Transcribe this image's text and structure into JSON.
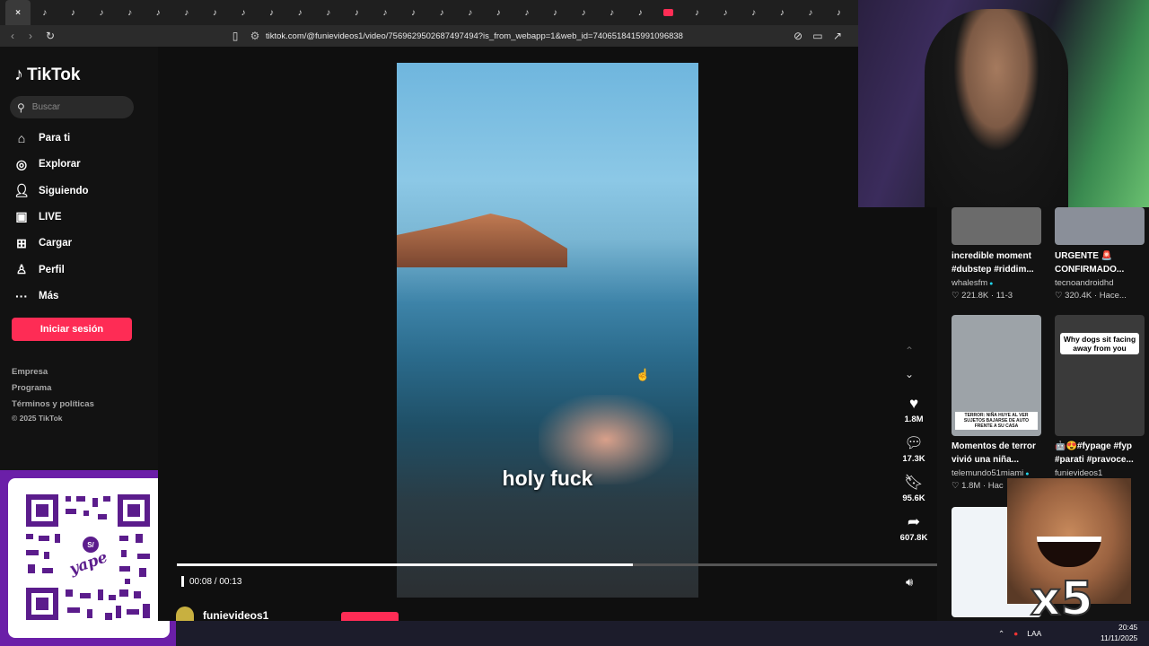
{
  "browser": {
    "tabs": [
      "×",
      "♪",
      "♪",
      "♪",
      "♪",
      "♪",
      "♪",
      "♪",
      "♪",
      "♪",
      "♪",
      "♪",
      "♪",
      "♪",
      "♪",
      "♪",
      "♪",
      "♪",
      "♪",
      "♪",
      "♪",
      "♪",
      "♪",
      "♪",
      "♪",
      "♪",
      "♪",
      "♪",
      "♪",
      "♪"
    ],
    "url": "tiktok.com/@funievideos1/video/7569629502687497494?is_from_webapp=1&web_id=7406518415991096838"
  },
  "sidebar": {
    "logo": "TikTok",
    "search_placeholder": "Buscar",
    "items": [
      {
        "label": "Para ti",
        "icon": "home-icon"
      },
      {
        "label": "Explorar",
        "icon": "compass-icon"
      },
      {
        "label": "Siguiendo",
        "icon": "following-icon"
      },
      {
        "label": "LIVE",
        "icon": "live-icon"
      },
      {
        "label": "Cargar",
        "icon": "upload-icon"
      },
      {
        "label": "Perfil",
        "icon": "profile-icon"
      },
      {
        "label": "Más",
        "icon": "more-icon"
      }
    ],
    "login_label": "Iniciar sesión",
    "footer": [
      "Empresa",
      "Programa",
      "Términos y políticas",
      "© 2025 TikTok"
    ]
  },
  "yape": {
    "brand": "yape",
    "badge": "S/"
  },
  "video": {
    "caption": "holy fuck",
    "time": "00:08 / 00:13",
    "progress": 0.6,
    "likes": "1.8M",
    "comments": "17.3K",
    "saves": "95.6K",
    "shares": "607.8K",
    "author": "funievideos1"
  },
  "recommended": [
    {
      "title": "incredible moment #dubstep #riddim...",
      "author": "whalesfm",
      "verified": true,
      "views": "221.8K",
      "date": "11-3",
      "thumb_color": "#6b6b6b"
    },
    {
      "title": "URGENTE 🚨 CONFIRMADO...",
      "author": "tecnoandroidhd",
      "verified": false,
      "views": "320.4K",
      "date": "Hace...",
      "thumb_color": "#8a8f99"
    },
    {
      "title": "Momentos de terror vivió una niña...",
      "author": "telemundo51miami",
      "verified": true,
      "views": "1.8M",
      "date": "Hac",
      "thumb_color": "#9da3a8",
      "overlay": "TERROR: NIÑA HUYE AL VER SUJETOS BAJARSE DE AUTO FRENTE A SU CASA"
    },
    {
      "title": "🤖😍#fypage #fyp #parati #pravoce...",
      "author": "funievideos1",
      "verified": false,
      "views": "",
      "date": "",
      "thumb_color": "#3a3a3a",
      "overlay": "Why dogs sit facing away from you"
    }
  ],
  "emote": {
    "text": "x5"
  },
  "taskbar": {
    "lang": "LAA",
    "time": "20:45",
    "date": "11/11/2025"
  }
}
